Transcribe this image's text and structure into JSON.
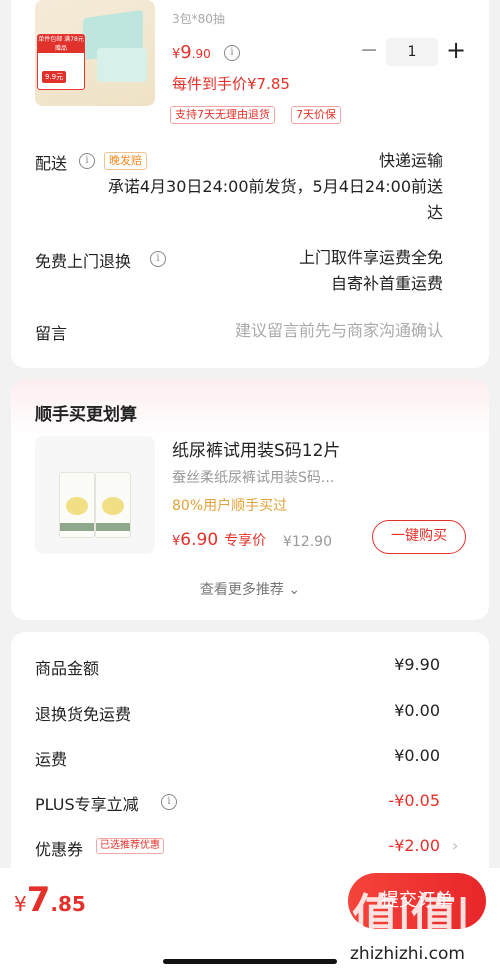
{
  "product": {
    "spec": "3包*80抽",
    "price_currency": "¥",
    "price_int": "9",
    "price_dec": ".90",
    "qty": "1",
    "minus": "−",
    "plus": "+",
    "per_item": "每件到手价¥7.85",
    "chips": [
      "支持7天无理由退货",
      "7天价保"
    ],
    "image_tag_top": "单件包邮 满78元赠品",
    "image_tag_price": "9.9元"
  },
  "delivery": {
    "label": "配送",
    "badge": "晚发赔",
    "method": "快递运输",
    "promise_line1": "承诺4月30日24:00前发货，5月4日24:00前送",
    "promise_line2": "达"
  },
  "returns": {
    "label": "免费上门退换",
    "line1": "上门取件享运费全免",
    "line2": "自寄补首重运费"
  },
  "message": {
    "label": "留言",
    "placeholder": "建议留言前先与商家沟通确认"
  },
  "recommend": {
    "title": "顺手买更划算",
    "item_title": "纸尿裤试用装S码12片",
    "item_sub": "蚕丝柔纸尿裤试用装S码...",
    "buyers": "80%用户顺手买过",
    "price_currency": "¥",
    "price": "6.90",
    "price_label": "专享价",
    "old_price": "¥12.90",
    "buy_label": "一键购买",
    "more": "查看更多推荐 ⌄"
  },
  "summary": {
    "rows": [
      {
        "label": "商品金额",
        "value": "¥9.90"
      },
      {
        "label": "退换货免运费",
        "value": "¥0.00"
      },
      {
        "label": "运费",
        "value": "¥0.00"
      },
      {
        "label": "PLUS专享立减",
        "value": "-¥0.05"
      },
      {
        "label": "优惠券",
        "value": "-¥2.00"
      }
    ],
    "coupon_badge": "已选推荐优惠"
  },
  "footer": {
    "total_currency": "¥",
    "total_int": "7",
    "total_dec": ".85",
    "submit_label": "提交订单",
    "watermark": "值|值|值",
    "watermark_url": "zhizhizhi.com"
  },
  "colors": {
    "accent_red": "#e5312b",
    "orange": "#f08a24",
    "gold": "#e0a23a"
  }
}
